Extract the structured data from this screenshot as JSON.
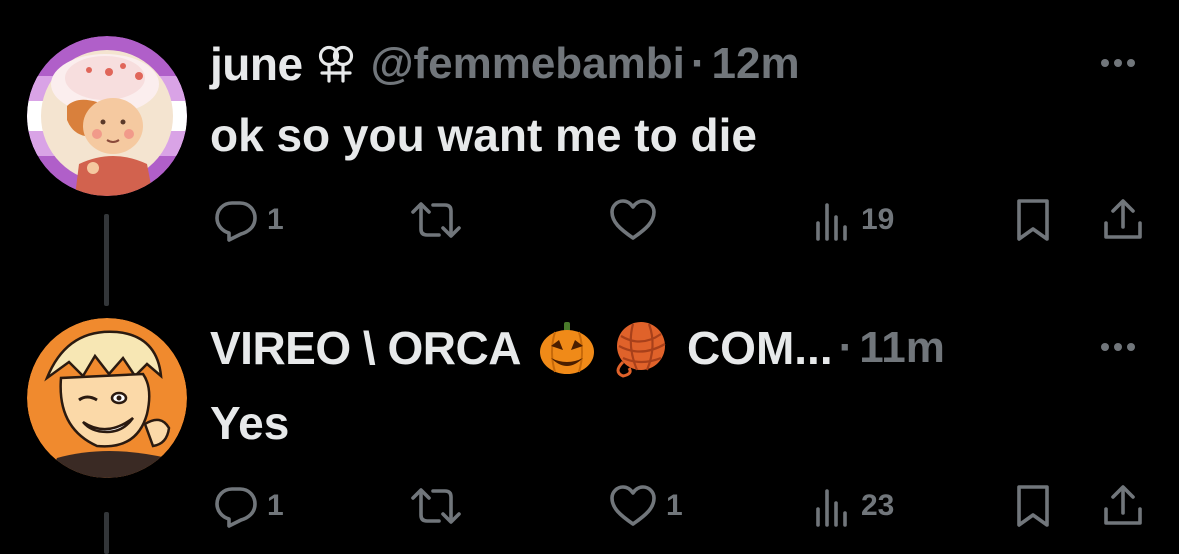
{
  "colors": {
    "background": "#000000",
    "primary_text": "#e7e9ea",
    "secondary_text": "#71767b",
    "thread_line": "#333639"
  },
  "tweets": [
    {
      "author": {
        "display_name": "june",
        "name_icon": "female-female-symbol-icon",
        "handle": "@femmebambi",
        "avatar": "strawberry-shortcake-avatar"
      },
      "separator": "·",
      "time": "12m",
      "text": "ok so you want me to die",
      "actions": {
        "reply_count": "1",
        "retweet_count": "",
        "like_count": "",
        "views_count": "19"
      }
    },
    {
      "author": {
        "display_name": "VIREO \\ ORCA",
        "name_emojis": [
          "jack-o-lantern-icon",
          "yarn-ball-icon"
        ],
        "community": "COM...",
        "avatar": "anime-boy-avatar"
      },
      "separator": "·",
      "time": "11m",
      "text": "Yes",
      "actions": {
        "reply_count": "1",
        "retweet_count": "",
        "like_count": "1",
        "views_count": "23"
      }
    }
  ]
}
